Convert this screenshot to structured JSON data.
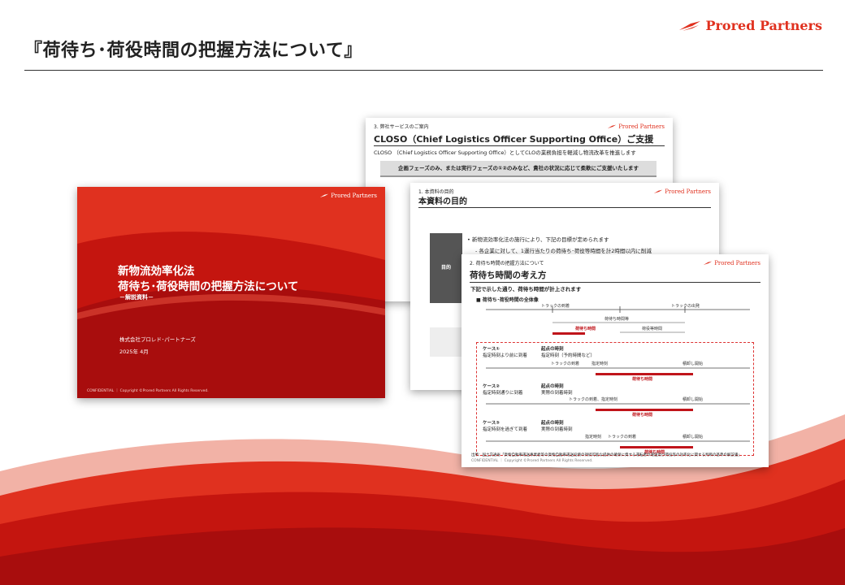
{
  "header": {
    "title": "『荷待ち･荷役時間の把握方法について』",
    "logo_text": "Prored Partners"
  },
  "slides": {
    "cover": {
      "title_line1": "新物流効率化法",
      "title_line2": "荷待ち･荷役時間の把握方法について",
      "subtitle": "－解説資料－",
      "company": "株式会社プロレド･パートナーズ",
      "date": "2025年 4月",
      "footer": "CONFIDENTIAL ｜ Copyright ©Prored Partners All Rights Reserved.",
      "logo_text": "Prored Partners"
    },
    "service": {
      "section": "3. 弊社サービスのご案内",
      "title": "CLOSO（Chief Logistics Officer Supporting Office）ご支援",
      "subtitle": "CLOSO （Chief Logistics Officer Supporting Office）としてCLOの業務負担を軽減し物流改革を推進します",
      "box": "企画フェーズのみ、または実行フェーズの①②のみなど、貴社の状況に応じて柔軟にご支援いたします",
      "logo_text": "Prored Partners"
    },
    "purpose": {
      "section": "1. 本資料の目的",
      "title": "本資料の目的",
      "label": "目的",
      "bullet1": "新物流効率化法の施行により、下記の目標が定められます",
      "bullet2": "各企業に対して、1運行当たりの荷待ち･荷役等時間を計2時間以内に削減",
      "logo_text": "Prored Partners"
    },
    "thinking": {
      "section": "2. 荷待ち時間の把握方法について",
      "title": "荷待ち時間の考え方",
      "lead": "下記で示した通り、荷待ち時間が計上されます",
      "overall": "■ 荷待ち･荷役時間の全体像",
      "truck_arrival": "トラックの到着",
      "truck_departure": "トラックの出発",
      "waiting_etc": "荷待ち時間等",
      "loading": "荷役等時間",
      "waiting": "荷待ち時間",
      "cases": [
        {
          "name": "ケース①",
          "desc": "指定時刻より前に到着",
          "start_label": "起点の時刻",
          "start_desc": "指定時刻（予約時間など）",
          "ev1": "トラックの到着",
          "ev2": "指定時刻",
          "ev3": "積卸し開始",
          "bar": "荷待ち時間"
        },
        {
          "name": "ケース②",
          "desc": "指定時刻通りに到着",
          "start_label": "起点の時刻",
          "start_desc": "実際の到着時刻",
          "ev1": "トラックの到着、指定時刻",
          "ev3": "積卸し開始",
          "bar": "荷待ち時間"
        },
        {
          "name": "ケース③",
          "desc": "指定時刻を過ぎて到着",
          "start_label": "起点の時刻",
          "start_desc": "実際の到着時刻",
          "ev1": "指定時刻",
          "ev2": "トラックの到着",
          "ev3": "積卸し開始",
          "bar": "荷待ち時間"
        }
      ],
      "source": "出所：国土交通省「貨物自動車運送事業者等の貨物自動車運送役務の持続可能な提供の確保に資する運転者の運送及び荷役等の効率化に関する判断の基準の解説書」",
      "footer": "CONFIDENTIAL ｜ Copyright ©Prored Partners All Rights Reserved.",
      "logo_text": "Prored Partners"
    }
  },
  "colors": {
    "brand_red": "#e0311f",
    "deep_red": "#a80d0d"
  }
}
